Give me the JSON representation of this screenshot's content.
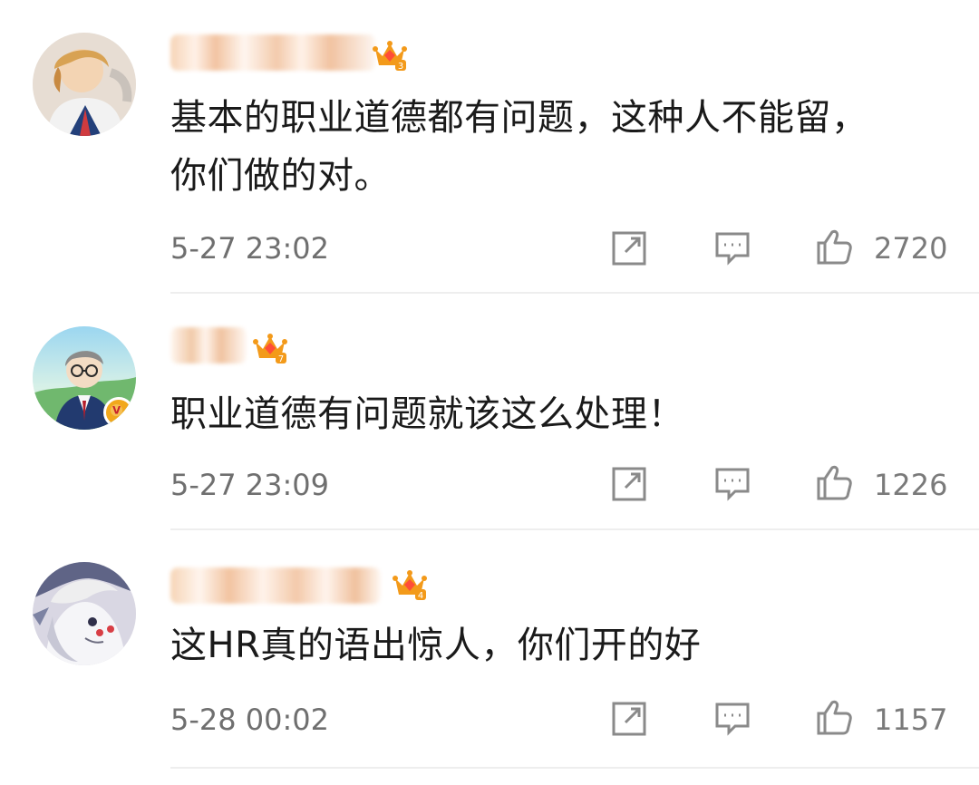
{
  "comments": [
    {
      "crown_level": "3",
      "text": "基本的职业道德都有问题，这种人不能留，\n你们做的对。",
      "time": "5-27 23:02",
      "likes": "2720",
      "avatar_icon": "avatar-photo-blonde"
    },
    {
      "crown_level": "7",
      "text": "职业道德有问题就该这么处理！",
      "time": "5-27 23:09",
      "likes": "1226",
      "avatar_icon": "avatar-cartoon-suit",
      "badge_label": "V"
    },
    {
      "crown_level": "4",
      "text": "这HR真的语出惊人，你们开的好",
      "time": "5-28 00:02",
      "likes": "1157",
      "avatar_icon": "avatar-anime-white-hair"
    }
  ],
  "colors": {
    "crown": "#f39a1a",
    "crown_gem": "#ff4d38",
    "blur_base": "#f0c6a4",
    "vip_badge": "#f2a81c",
    "meta_gray": "#6f6f6f"
  },
  "icons": {
    "share": "share-icon",
    "comment": "comment-icon",
    "like": "thumbs-up-icon"
  }
}
